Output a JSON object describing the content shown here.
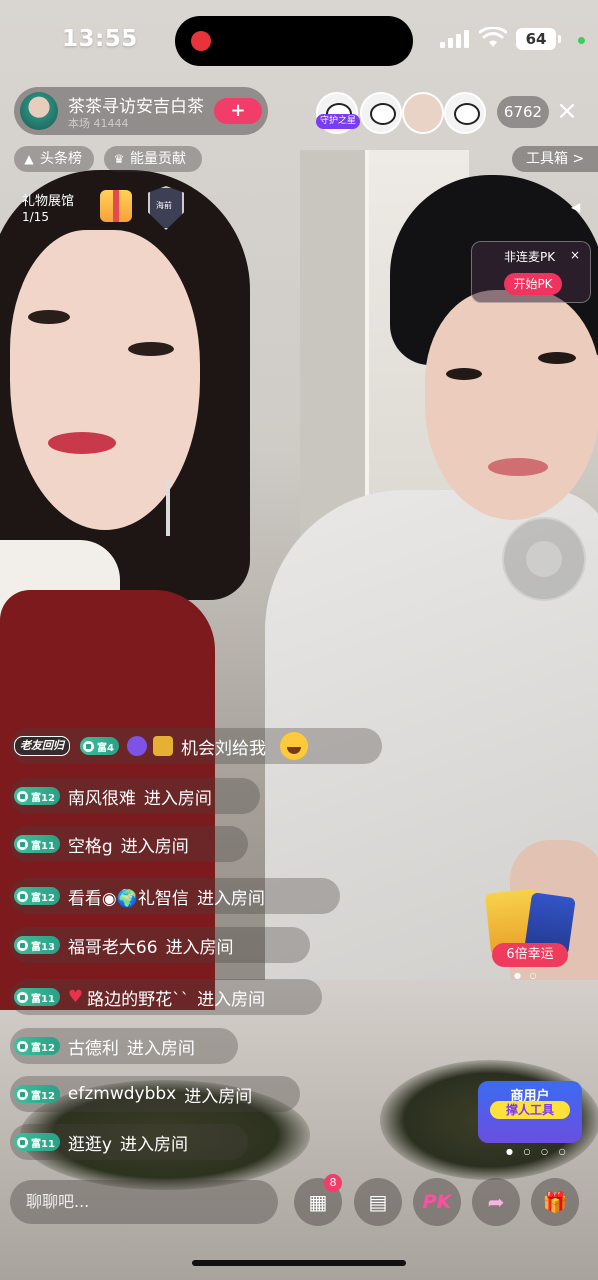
{
  "status_bar": {
    "time": "13:55",
    "battery": "64"
  },
  "host": {
    "name": "茶茶寻访安吉白茶",
    "sub": "本场 41444",
    "follow_glyph": "+"
  },
  "viewers": {
    "guard_label": "守护之星",
    "count": "6762"
  },
  "chips": {
    "headline": "头条榜",
    "energy": "能量贡献",
    "toolbox": "工具箱 >"
  },
  "gift_hall": {
    "label": "礼物展馆",
    "page": "1/15",
    "shield_text": "海前"
  },
  "pk_card": {
    "title": "非连麦PK",
    "start": "开始PK",
    "close": "×"
  },
  "chat": [
    {
      "badge": "老友回归",
      "level": "富4",
      "name": "机会刘给我",
      "action": ""
    },
    {
      "level": "富12",
      "name": "南风很难",
      "action": "进入房间"
    },
    {
      "level": "富11",
      "name": "空格g",
      "action": "进入房间"
    },
    {
      "level": "富12",
      "name": "看看◉🌍礼智信",
      "action": "进入房间"
    },
    {
      "level": "富13",
      "name": "福哥老大66",
      "action": "进入房间"
    },
    {
      "level": "富11",
      "name": "路边的野花``",
      "action": "进入房间"
    },
    {
      "level": "富12",
      "name": "古德利",
      "action": "进入房间"
    },
    {
      "level": "富12",
      "name": "efzmwdybbx",
      "action": "进入房间"
    },
    {
      "level": "富11",
      "name": "逛逛y",
      "action": "进入房间"
    }
  ],
  "promos": {
    "card1_label": "6倍幸运",
    "card2_line1": "商用户",
    "card2_line2": "撑人工具"
  },
  "bottom": {
    "input_placeholder": "聊聊吧...",
    "notif_count": "8",
    "pk_label": "PK"
  },
  "colors": {
    "accent": "#f23d6b",
    "level_badge": "#2aa086",
    "pk_pink": "#ff4fa0"
  },
  "icons": [
    "record-icon",
    "signal-icon",
    "wifi-icon",
    "battery-icon",
    "gift-icon",
    "shield-icon",
    "grid-icon",
    "chat-icon",
    "pk-icon",
    "share-icon",
    "gift-box-icon"
  ]
}
